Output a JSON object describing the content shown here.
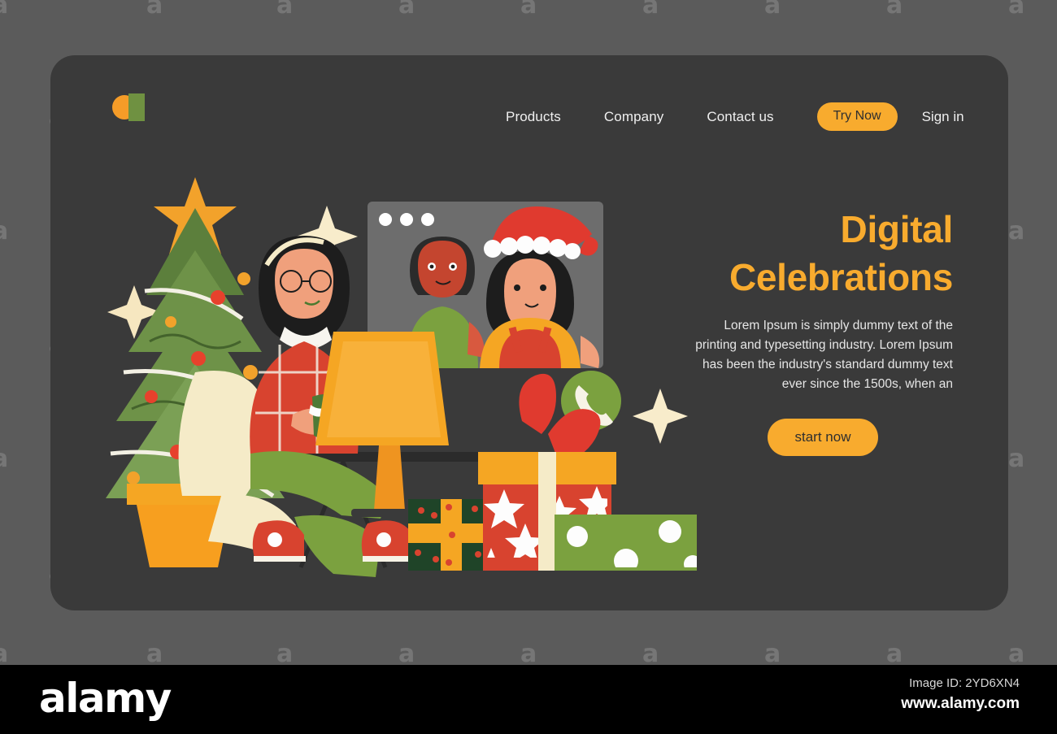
{
  "colors": {
    "page_bg": "#5b5b5b",
    "card_bg": "#3a3a3a",
    "accent_orange": "#f8ab2e",
    "logo_green": "#6f9141",
    "text_light": "#efefef",
    "footer_bg": "#000000"
  },
  "watermark": {
    "letter": "a",
    "brand": "alamy"
  },
  "header": {
    "logo_name": "brand-logo",
    "nav": [
      {
        "label": "Products"
      },
      {
        "label": "Company"
      },
      {
        "label": "Contact us"
      }
    ],
    "try_now_label": "Try Now",
    "sign_in_label": "Sign in"
  },
  "hero": {
    "headline_line1": "Digital",
    "headline_line2": "Celebrations",
    "paragraph": "Lorem Ipsum is simply dummy text of the printing and typesetting industry. Lorem Ipsum has been the industry's standard dummy text ever since the 1500s, when an",
    "cta_label": "start now"
  },
  "illustration": {
    "name": "christmas-video-call-illustration",
    "elements": [
      "christmas-tree",
      "tree-star",
      "tree-pot",
      "seated-woman",
      "laptop",
      "desk",
      "office-chair",
      "video-call-window",
      "call-participant-man",
      "call-participant-woman-santa-hat",
      "phone-badge",
      "gift-box-green",
      "gift-box-red",
      "gift-box-olive",
      "sparkle"
    ]
  },
  "footer": {
    "brand": "alamy",
    "image_id": "Image ID: 2YD6XN4",
    "url": "www.alamy.com"
  }
}
